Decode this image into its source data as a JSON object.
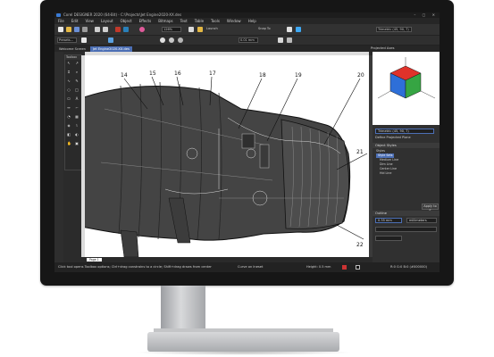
{
  "window": {
    "title": "Corel DESIGNER 2020 (64-Bit) - C:\\Projects\\Jet Engine2020-XX.des",
    "controls": "–  ▢  ✕"
  },
  "menu": [
    "File",
    "Edit",
    "View",
    "Layout",
    "Object",
    "Effects",
    "Bitmaps",
    "Text",
    "Table",
    "Tools",
    "Window",
    "Help"
  ],
  "toolbar": {
    "zoom": "126%",
    "launch": "Launch",
    "snap": "Snap To",
    "view": "Trimetric (45, 90, 7)"
  },
  "property_bar": {
    "preset": "Presets...",
    "size": "0.01 mm"
  },
  "tabs": [
    {
      "label": "Welcome Screen",
      "active": false
    },
    {
      "label": "Jet Engine2020-XX.des",
      "active": true
    }
  ],
  "dock_title": "Projected Axes",
  "toolbox_title": "Toolbox",
  "callouts": [
    "14",
    "15",
    "16",
    "17",
    "18",
    "19",
    "20",
    "21",
    "22"
  ],
  "object_styles": {
    "view_select": "Trimetric (45, 90, 7)",
    "define_plane": "Define Projected Plane",
    "header": "Object Styles",
    "items": [
      "Styles",
      "Style Sets",
      "Medium Line",
      "Dim Line",
      "Center Line",
      "Hid Line"
    ],
    "apply_button": "Apply to S"
  },
  "outline": {
    "header": "Outline",
    "width": "0.35 mm",
    "units": "millimeters"
  },
  "page_label": "Page 1",
  "status": {
    "hint": "Click tool opens Toolbox options; Ctrl+drag constrains to a circle; Shift+drag draws from center",
    "object": "Curve on Ineset",
    "size": "Height: 0.5 mm",
    "color_readout": "R:0 G:0 B:0 (#000000)"
  },
  "colors": {
    "accent": "#4c6fb5",
    "cube_top": "#e0322a",
    "cube_left": "#2e6fd8",
    "cube_right": "#36a543"
  }
}
